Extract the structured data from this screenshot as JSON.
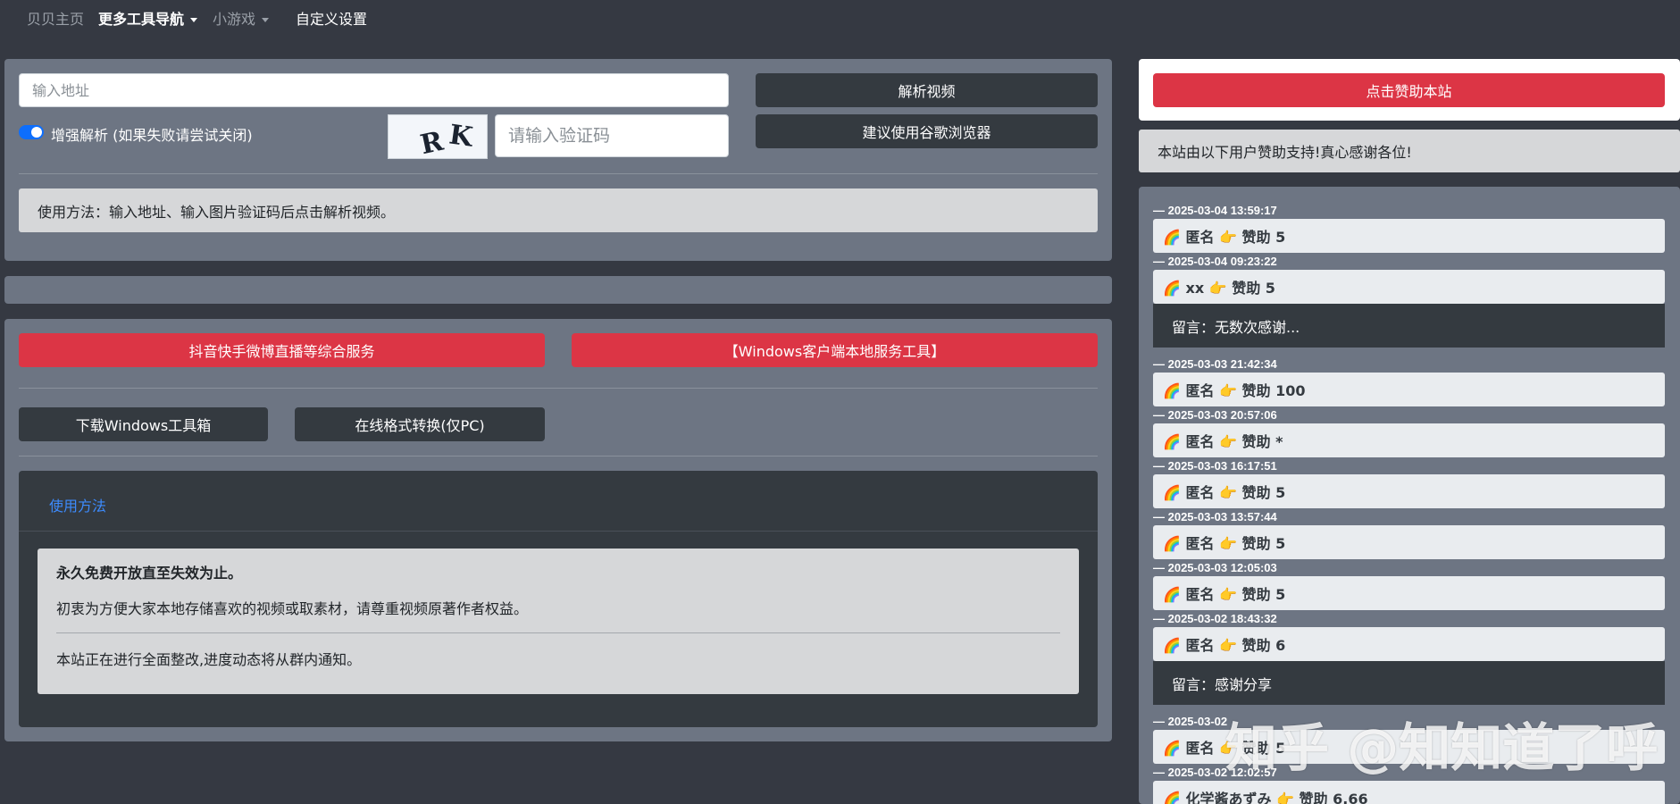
{
  "nav": {
    "home": "贝贝主页",
    "more_tools": "更多工具导航",
    "mini_games": "小游戏",
    "custom_settings": "自定义设置"
  },
  "parser": {
    "url_placeholder": "输入地址",
    "parse_button": "解析视频",
    "enhance_toggle_label": "增强解析 (如果失败请尝试关闭)",
    "enhance_enabled": true,
    "captcha_text": "R K",
    "captcha_placeholder": "请输入验证码",
    "browser_button": "建议使用谷歌浏览器",
    "usage_hint": "使用方法：输入地址、输入图片验证码后点击解析视频。"
  },
  "services": {
    "live_service_button": "抖音快手微博直播等综合服务",
    "windows_client_button": "【Windows客户端本地服务工具】",
    "download_toolbox_button": "下载Windows工具箱",
    "format_convert_button": "在线格式转换(仅PC)"
  },
  "usage": {
    "title": "使用方法",
    "line1": "永久免费开放直至失效为止。",
    "line2": "初衷为方便大家本地存储喜欢的视频或取素材，请尊重视频原著作者权益。",
    "line3": "本站正在进行全面整改,进度动态将从群内通知。"
  },
  "sponsor": {
    "donate_button": "点击赞助本站",
    "thanks_text": "本站由以下用户赞助支持!真心感谢各位!",
    "entries": [
      {
        "time": "— 2025-03-04 13:59:17",
        "text": "🌈 匿名 👉 赞助  5"
      },
      {
        "time": "— 2025-03-04 09:23:22",
        "text": "🌈 xx 👉 赞助  5",
        "message": "留言：无数次感谢..."
      },
      {
        "time": "— 2025-03-03 21:42:34",
        "text": "🌈 匿名 👉 赞助  100"
      },
      {
        "time": "— 2025-03-03 20:57:06",
        "text": "🌈 匿名 👉 赞助  *"
      },
      {
        "time": "— 2025-03-03 16:17:51",
        "text": "🌈 匿名 👉 赞助  5"
      },
      {
        "time": "— 2025-03-03 13:57:44",
        "text": "🌈 匿名 👉 赞助  5"
      },
      {
        "time": "— 2025-03-03 12:05:03",
        "text": "🌈 匿名 👉 赞助  5"
      },
      {
        "time": "— 2025-03-02 18:43:32",
        "text": "🌈 匿名 👉 赞助  6",
        "message": "留言：感谢分享"
      },
      {
        "time": "— 2025-03-02",
        "text": "🌈 匿名 👉 赞助  5"
      },
      {
        "time": "— 2025-03-02 12:02:57",
        "text": "🌈 化学酱あずみ 👉 赞助  6.66"
      }
    ]
  },
  "watermark": "知乎 @知知道了呼",
  "colors": {
    "background": "#353942",
    "card": "#6d7583",
    "dark_button": "#343a40",
    "red_button": "#dc3545",
    "link_blue": "#3d8bfd",
    "toggle_blue": "#0d6efd"
  }
}
